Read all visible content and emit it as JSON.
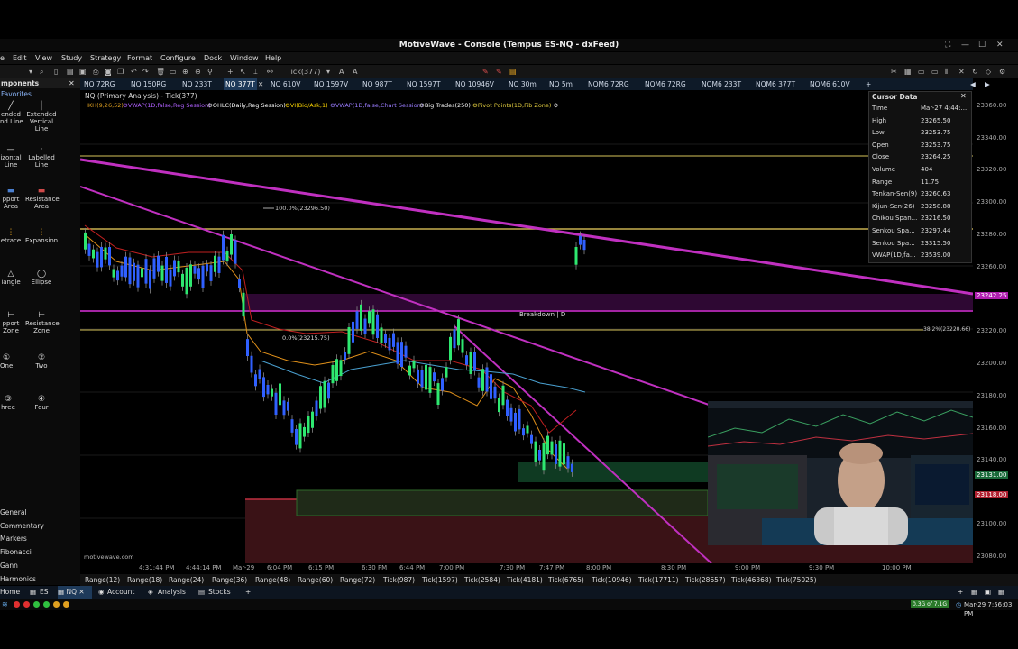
{
  "window": {
    "title": "MotiveWave - Console (Tempus ES-NQ - dxFeed)"
  },
  "menu": [
    "e",
    "Edit",
    "View",
    "Study",
    "Strategy",
    "Format",
    "Configure",
    "Dock",
    "Window",
    "Help"
  ],
  "toolbar": {
    "bar_size": "Tick(377)"
  },
  "left_panel": {
    "header": "mponents",
    "favorites": "Favorites",
    "tools": [
      {
        "label": "Extended Line",
        "shown": "ended\nnd Line"
      },
      {
        "label": "Extended Vertical Line"
      },
      {
        "label": "Horizontal Line",
        "shown": "izontal\nLine"
      },
      {
        "label": "Labelled Line"
      },
      {
        "label": "Support Area",
        "shown": "pport\nArea"
      },
      {
        "label": "Resistance Area"
      },
      {
        "label": "Retrace",
        "shown": "etrace"
      },
      {
        "label": "Expansion"
      },
      {
        "label": "Triangle",
        "shown": "iangle"
      },
      {
        "label": "Ellipse"
      },
      {
        "label": "Support Zone",
        "shown": "pport\nZone"
      },
      {
        "label": "Resistance Zone"
      },
      {
        "label": "One",
        "shown": "One"
      },
      {
        "label": "Two"
      },
      {
        "label": "Three",
        "shown": "hree"
      },
      {
        "label": "Four"
      }
    ],
    "categories": [
      "General",
      "Commentary",
      "Markers",
      "Fibonacci",
      "Gann",
      "Harmonics"
    ]
  },
  "tabs": [
    "NQ 72RG",
    "NQ 150RG",
    "NQ 233T",
    "NQ 377T",
    "NQ 610V",
    "NQ 1597V",
    "NQ 987T",
    "NQ 1597T",
    "NQ 10946V",
    "NQ 30m",
    "NQ 5m",
    "NQM6 72RG",
    "NQM6 72RG",
    "NQM6 233T",
    "NQM6 377T",
    "NQM6 610V"
  ],
  "active_tab": "NQ 377T",
  "chart": {
    "title": "NQ (Primary Analysis) - Tick(377)",
    "indicators": [
      {
        "text": "IKH(9,26,52)",
        "color": "#e0a020"
      },
      {
        "text": "VWAP(1D,false,Reg Session)",
        "color": "#b060ff"
      },
      {
        "text": "OHLC(Daily,Reg Session)",
        "color": "#ffffff"
      },
      {
        "text": "VI(Bid/Ask,1)",
        "color": "#ffd700"
      },
      {
        "text": "VWAP(1D,false,Chart Session)",
        "color": "#9a7cff"
      },
      {
        "text": "Big Trades(250)",
        "color": "#ffffff"
      },
      {
        "text": "Pivot Points(1D,Fib Zone)",
        "color": "#e6d040"
      }
    ],
    "annotations": {
      "fib100": "100.0%(23296.50)",
      "fib0": "0.0%(23215.75)",
      "fib382": "38.2%(23220.66)",
      "breakdown": "Breakdown | D",
      "watermark": "motivewave.com"
    },
    "price_tag_upper": "23242.25",
    "price_tag_mid": "23131.00",
    "price_tag_low": "23118.00"
  },
  "cursor_data": {
    "title": "Cursor Data",
    "rows": [
      [
        "Time",
        "Mar-27 4:44:..."
      ],
      [
        "High",
        "23265.50"
      ],
      [
        "Low",
        "23253.75"
      ],
      [
        "Open",
        "23253.75"
      ],
      [
        "Close",
        "23264.25"
      ],
      [
        "Volume",
        "404"
      ],
      [
        "Range",
        "11.75"
      ],
      [
        "Tenkan-Sen(9)",
        "23260.63"
      ],
      [
        "Kijun-Sen(26)",
        "23258.88"
      ],
      [
        "Chikou Span...",
        "23216.50"
      ],
      [
        "Senkou Spa...",
        "23297.44"
      ],
      [
        "Senkou Spa...",
        "23315.50"
      ],
      [
        "VWAP(1D,fa...",
        "23539.00"
      ]
    ]
  },
  "y_axis": [
    "23360.00",
    "23340.00",
    "23320.00",
    "23300.00",
    "23280.00",
    "23260.00",
    "23220.00",
    "23200.00",
    "23180.00",
    "23160.00",
    "23140.00",
    "23100.00",
    "23080.00"
  ],
  "x_axis": [
    "4:31:44 PM",
    "4:44:14 PM",
    "Mar-29",
    "6:04 PM",
    "6:15 PM",
    "6:30 PM",
    "6:44 PM",
    "7:00 PM",
    "7:30 PM",
    "7:47 PM",
    "8:00 PM",
    "8:30 PM",
    "9:00 PM",
    "9:30 PM",
    "10:00 PM"
  ],
  "range_bar": [
    "Range(12)",
    "Range(18)",
    "Range(24)",
    "Range(36)",
    "Range(48)",
    "Range(60)",
    "Range(72)",
    "Tick(987)",
    "Tick(1597)",
    "Tick(2584)",
    "Tick(4181)",
    "Tick(6765)",
    "Tick(10946)",
    "Tick(17711)",
    "Tick(28657)",
    "Tick(46368)",
    "Tick(75025)"
  ],
  "bottom_tabs": [
    "Home",
    "ES",
    "NQ",
    "Account",
    "Analysis",
    "Stocks",
    "+"
  ],
  "status": {
    "memory": "0.3G of 7.1G",
    "datetime": "Mar-29 7:56:03 PM"
  }
}
